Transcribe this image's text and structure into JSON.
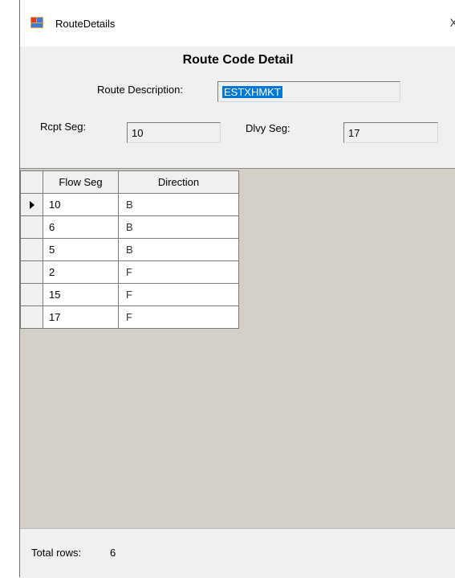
{
  "window": {
    "title": "RouteDetails",
    "close_glyph": "X"
  },
  "header": {
    "heading": "Route Code Detail",
    "route_description_label": "Route Description:",
    "route_description_value": "ESTXHMKT",
    "rcpt_seg_label": "Rcpt Seg:",
    "rcpt_seg_value": "10",
    "dlvy_seg_label": "Dlvy Seg:",
    "dlvy_seg_value": "17"
  },
  "grid": {
    "columns": [
      "Flow Seg",
      "Direction"
    ],
    "rows": [
      {
        "flow_seg": "10",
        "direction": "B",
        "current": true
      },
      {
        "flow_seg": "6",
        "direction": "B"
      },
      {
        "flow_seg": "5",
        "direction": "B"
      },
      {
        "flow_seg": "2",
        "direction": "F"
      },
      {
        "flow_seg": "15",
        "direction": "F"
      },
      {
        "flow_seg": "17",
        "direction": "F"
      }
    ],
    "current_row_icon": "row-pointer-icon"
  },
  "status": {
    "total_rows_label": "Total rows:",
    "total_rows_value": "6"
  },
  "colors": {
    "selection": "#0078d7",
    "grid_background": "#d4d0c8",
    "form_background": "#f0f0f0"
  }
}
